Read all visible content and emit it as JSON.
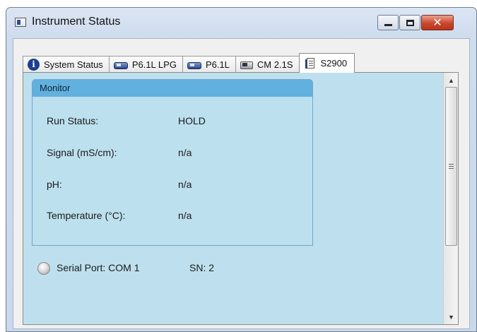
{
  "window": {
    "title": "Instrument Status",
    "controls": {
      "minimize": "",
      "maximize": "",
      "close": "✕"
    }
  },
  "tabs": [
    {
      "label": "System Status",
      "icon": "info-icon"
    },
    {
      "label": "P6.1L LPG",
      "icon": "device-icon"
    },
    {
      "label": "P6.1L",
      "icon": "device-icon"
    },
    {
      "label": "CM 2.1S",
      "icon": "grey-device-icon"
    },
    {
      "label": "S2900",
      "icon": "document-icon",
      "active": true
    }
  ],
  "monitor": {
    "header": "Monitor",
    "rows": [
      {
        "label": "Run Status:",
        "value": "HOLD"
      },
      {
        "label": "Signal (mS/cm):",
        "value": "n/a"
      },
      {
        "label": "pH:",
        "value": "n/a"
      },
      {
        "label": "Temperature (°C):",
        "value": "n/a"
      }
    ]
  },
  "footer": {
    "serial_port": "Serial Port: COM  1",
    "sn": "SN:  2"
  },
  "scrollbar": {
    "up_arrow": "▲",
    "down_arrow": "▼"
  },
  "colors": {
    "panel_bg": "#bee0ee",
    "monitor_header": "#62b0de",
    "close_button": "#c9472d"
  }
}
